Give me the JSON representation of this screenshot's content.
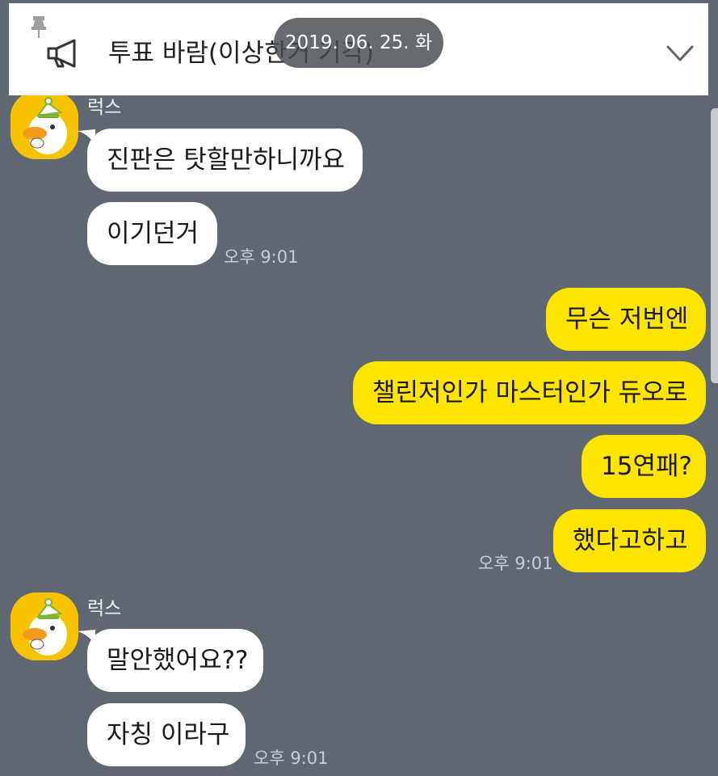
{
  "notice": {
    "text": "투표 바람(이상한거 기각)",
    "icons": [
      "pin-icon",
      "megaphone-icon",
      "chevron-down-icon"
    ]
  },
  "date_pill": "2019. 06. 25. 화",
  "colors": {
    "background": "#5f6772",
    "incoming_bubble": "#ffffff",
    "outgoing_bubble": "#fee500",
    "avatar": "#f7c300"
  },
  "groups": [
    {
      "sender": "럭스",
      "messages": [
        "진판은 탓할만하니까요",
        "이기던거"
      ],
      "time": "오후 9:01"
    },
    {
      "sender": "me",
      "messages": [
        "무슨 저번엔",
        "챌린저인가 마스터인가 듀오로",
        "15연패?",
        "했다고하고"
      ],
      "time": "오후 9:01"
    },
    {
      "sender": "럭스",
      "messages": [
        "말안했어요??",
        "자칭 이라구"
      ],
      "time": "오후 9:01"
    }
  ]
}
